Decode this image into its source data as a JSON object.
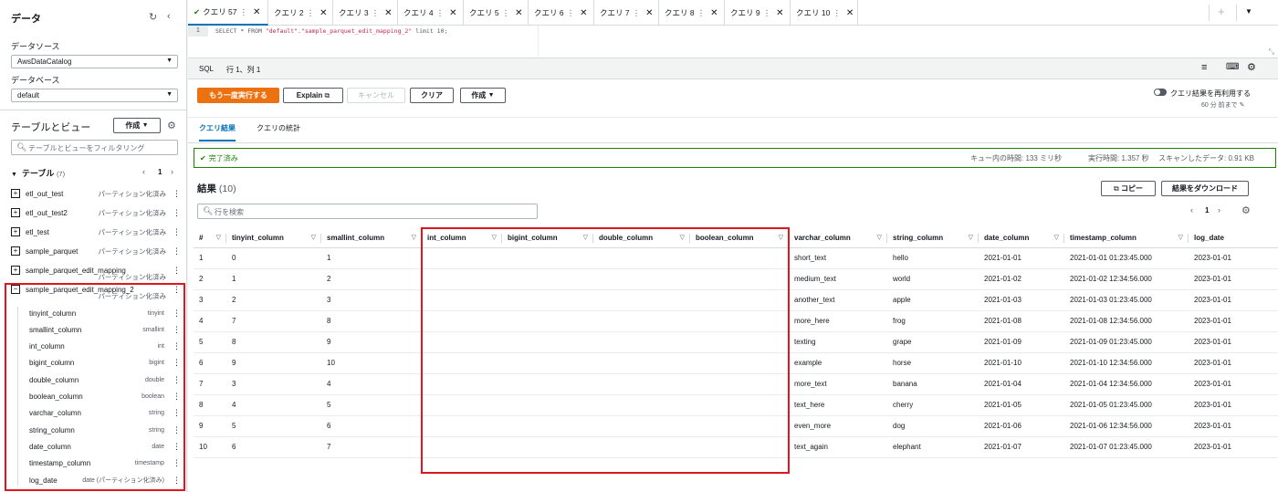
{
  "sidebar": {
    "title": "データ",
    "datasource_label": "データソース",
    "datasource_value": "AwsDataCatalog",
    "database_label": "データベース",
    "database_value": "default",
    "tables_views_title": "テーブルとビュー",
    "create_label": "作成",
    "filter_placeholder": "テーブルとビューをフィルタリング",
    "tables_header": "テーブル",
    "tables_count": "(7)",
    "page": "1",
    "tables": [
      {
        "name": "etl_out_test",
        "tag": "パーティション化済み"
      },
      {
        "name": "etl_out_test2",
        "tag": "パーティション化済み"
      },
      {
        "name": "etl_test",
        "tag": "パーティション化済み"
      },
      {
        "name": "sample_parquet",
        "tag": "パーティション化済み"
      },
      {
        "name": "sample_parquet_edit_mapping",
        "tag": "パーティション化済み"
      },
      {
        "name": "sample_parquet_edit_mapping_2",
        "tag": "パーティション化済み"
      }
    ],
    "columns": [
      {
        "name": "tinyint_column",
        "type": "tinyint"
      },
      {
        "name": "smallint_column",
        "type": "smallint"
      },
      {
        "name": "int_column",
        "type": "int"
      },
      {
        "name": "bigint_column",
        "type": "bigint"
      },
      {
        "name": "double_column",
        "type": "double"
      },
      {
        "name": "boolean_column",
        "type": "boolean"
      },
      {
        "name": "varchar_column",
        "type": "string"
      },
      {
        "name": "string_column",
        "type": "string"
      },
      {
        "name": "date_column",
        "type": "date"
      },
      {
        "name": "timestamp_column",
        "type": "timestamp"
      },
      {
        "name": "log_date",
        "type": "date (パーティション化済み)"
      }
    ]
  },
  "tabs": [
    "クエリ 57",
    "クエリ 2",
    "クエリ 3",
    "クエリ 4",
    "クエリ 5",
    "クエリ 6",
    "クエリ 7",
    "クエリ 8",
    "クエリ 9",
    "クエリ 10"
  ],
  "editor": {
    "line": "1",
    "code_prefix": "SELECT * FROM ",
    "code_string": "\"default\".\"sample_parquet_edit_mapping_2\"",
    "code_suffix": " limit 10;"
  },
  "status": {
    "lang": "SQL",
    "position": "行 1、列 1"
  },
  "toolbar": {
    "rerun": "もう一度実行する",
    "explain": "Explain",
    "cancel": "キャンセル",
    "clear": "クリア",
    "create": "作成",
    "reuse": "クエリ結果を再利用する",
    "reuse_age": "60 分 前まで"
  },
  "result_tabs": {
    "results": "クエリ結果",
    "stats": "クエリの統計"
  },
  "completion": {
    "status": "完了済み",
    "queue": "キュー内の時間: 133 ミリ秒",
    "runtime": "実行時間: 1.357 秒",
    "scanned": "スキャンしたデータ: 0.91 KB"
  },
  "results": {
    "title": "結果",
    "count": "(10)",
    "copy": "コピー",
    "download": "結果をダウンロード",
    "search_placeholder": "行を検索",
    "page": "1",
    "columns": [
      "#",
      "tinyint_column",
      "smallint_column",
      "int_column",
      "bigint_column",
      "double_column",
      "boolean_column",
      "varchar_column",
      "string_column",
      "date_column",
      "timestamp_column",
      "log_date"
    ],
    "rows": [
      [
        "1",
        "0",
        "1",
        "",
        "",
        "",
        "",
        "short_text",
        "hello",
        "2021-01-01",
        "2021-01-01 01:23:45.000",
        "2023-01-01"
      ],
      [
        "2",
        "1",
        "2",
        "",
        "",
        "",
        "",
        "medium_text",
        "world",
        "2021-01-02",
        "2021-01-02 12:34:56.000",
        "2023-01-01"
      ],
      [
        "3",
        "2",
        "3",
        "",
        "",
        "",
        "",
        "another_text",
        "apple",
        "2021-01-03",
        "2021-01-03 01:23:45.000",
        "2023-01-01"
      ],
      [
        "4",
        "7",
        "8",
        "",
        "",
        "",
        "",
        "more_here",
        "frog",
        "2021-01-08",
        "2021-01-08 12:34:56.000",
        "2023-01-01"
      ],
      [
        "5",
        "8",
        "9",
        "",
        "",
        "",
        "",
        "texting",
        "grape",
        "2021-01-09",
        "2021-01-09 01:23:45.000",
        "2023-01-01"
      ],
      [
        "6",
        "9",
        "10",
        "",
        "",
        "",
        "",
        "example",
        "horse",
        "2021-01-10",
        "2021-01-10 12:34:56.000",
        "2023-01-01"
      ],
      [
        "7",
        "3",
        "4",
        "",
        "",
        "",
        "",
        "more_text",
        "banana",
        "2021-01-04",
        "2021-01-04 12:34:56.000",
        "2023-01-01"
      ],
      [
        "8",
        "4",
        "5",
        "",
        "",
        "",
        "",
        "text_here",
        "cherry",
        "2021-01-05",
        "2021-01-05 01:23:45.000",
        "2023-01-01"
      ],
      [
        "9",
        "5",
        "6",
        "",
        "",
        "",
        "",
        "even_more",
        "dog",
        "2021-01-06",
        "2021-01-06 12:34:56.000",
        "2023-01-01"
      ],
      [
        "10",
        "6",
        "7",
        "",
        "",
        "",
        "",
        "text_again",
        "elephant",
        "2021-01-07",
        "2021-01-07 01:23:45.000",
        "2023-01-01"
      ]
    ]
  },
  "colors": {
    "accent": "#0073bb",
    "primary_button": "#ec7211",
    "success": "#1d8102",
    "highlight": "#e0161f"
  }
}
